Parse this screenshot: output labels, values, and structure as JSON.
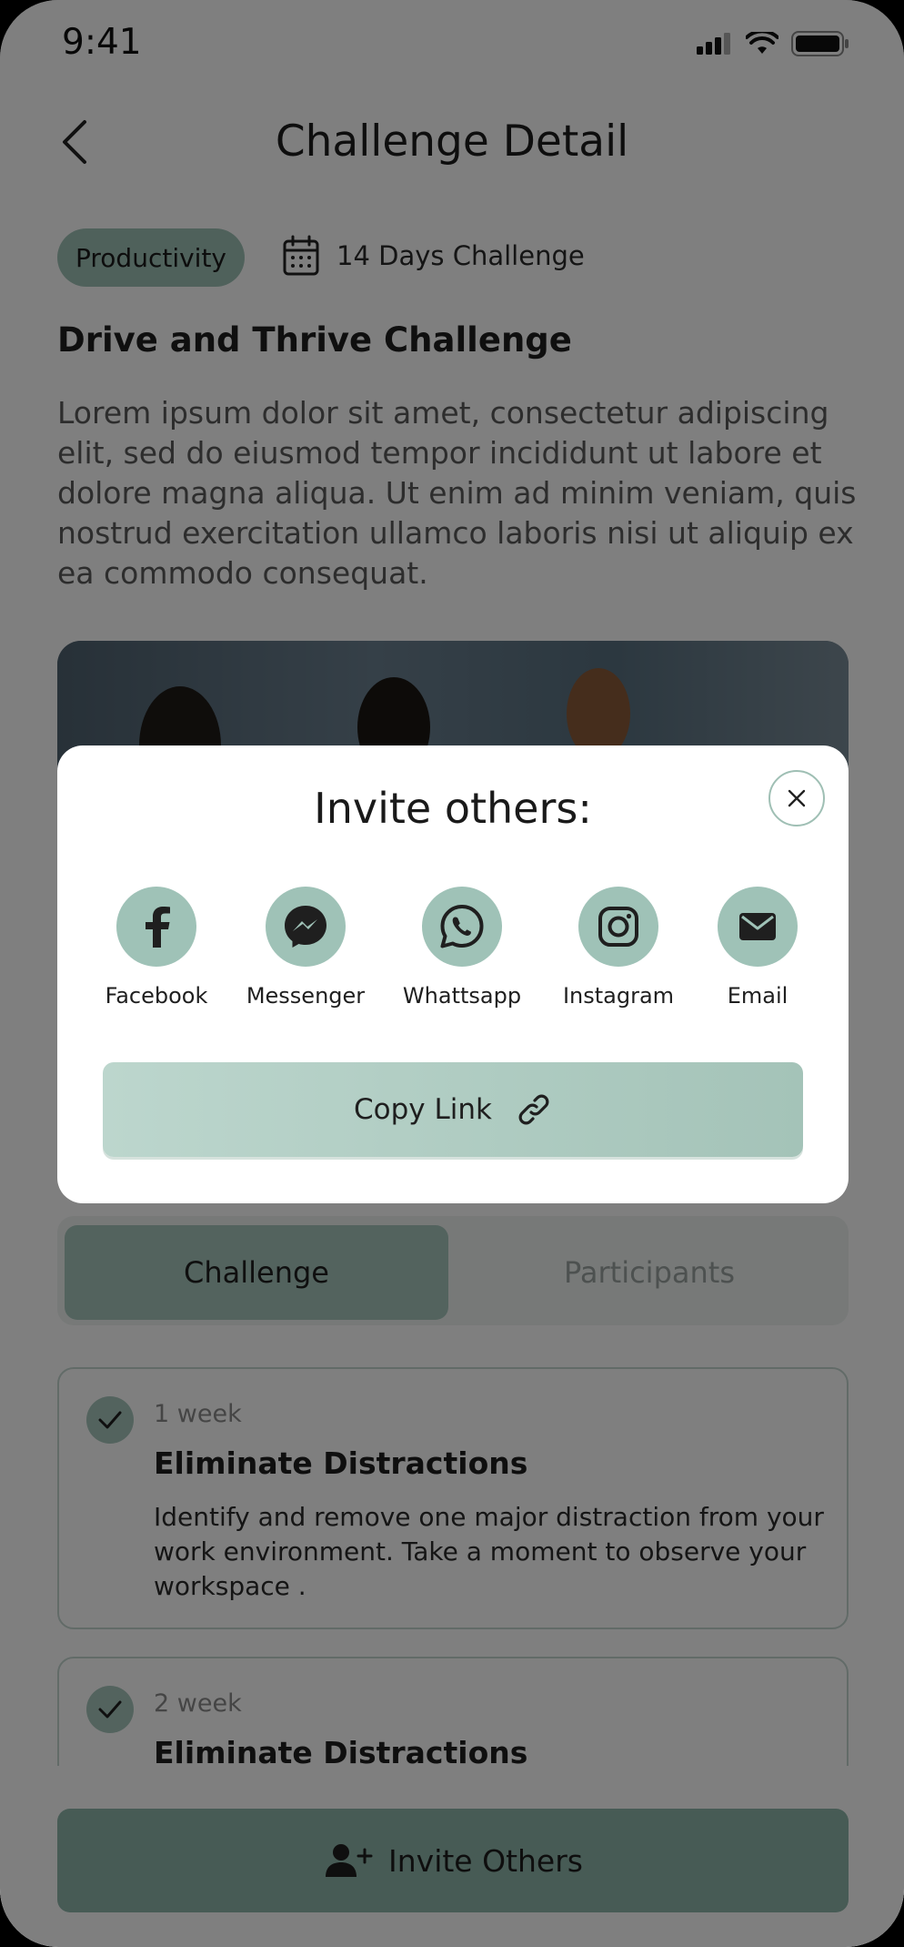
{
  "status_bar": {
    "time": "9:41"
  },
  "header": {
    "title": "Challenge Detail"
  },
  "tags": {
    "category": "Productivity",
    "duration": "14 Days Challenge"
  },
  "challenge": {
    "name": "Drive and Thrive Challenge",
    "description": "Lorem ipsum dolor sit amet, consectetur adipiscing elit, sed do eiusmod tempor incididunt ut labore et dolore magna aliqua. Ut enim ad minim veniam, quis nostrud exercitation ullamco laboris nisi ut aliquip ex ea commodo consequat."
  },
  "tabs": [
    {
      "label": "Challenge",
      "active": true
    },
    {
      "label": "Participants",
      "active": false
    }
  ],
  "weeks": [
    {
      "label": "1 week",
      "title": "Eliminate Distractions",
      "description": "Identify and remove one major distraction from your work environment. Take a moment to observe your workspace ."
    },
    {
      "label": "2 week",
      "title": "Eliminate Distractions"
    }
  ],
  "bottom": {
    "invite_label": "Invite Others"
  },
  "modal": {
    "title": "Invite others:",
    "share_options": [
      {
        "label": "Facebook",
        "icon": "facebook-icon"
      },
      {
        "label": "Messenger",
        "icon": "messenger-icon"
      },
      {
        "label": "Whattsapp",
        "icon": "whatsapp-icon"
      },
      {
        "label": "Instagram",
        "icon": "instagram-icon"
      },
      {
        "label": "Email",
        "icon": "email-icon"
      }
    ],
    "copy_link_label": "Copy Link"
  },
  "colors": {
    "accent": "#9fc2b7",
    "overlay": "rgba(0,0,0,0.5)"
  }
}
